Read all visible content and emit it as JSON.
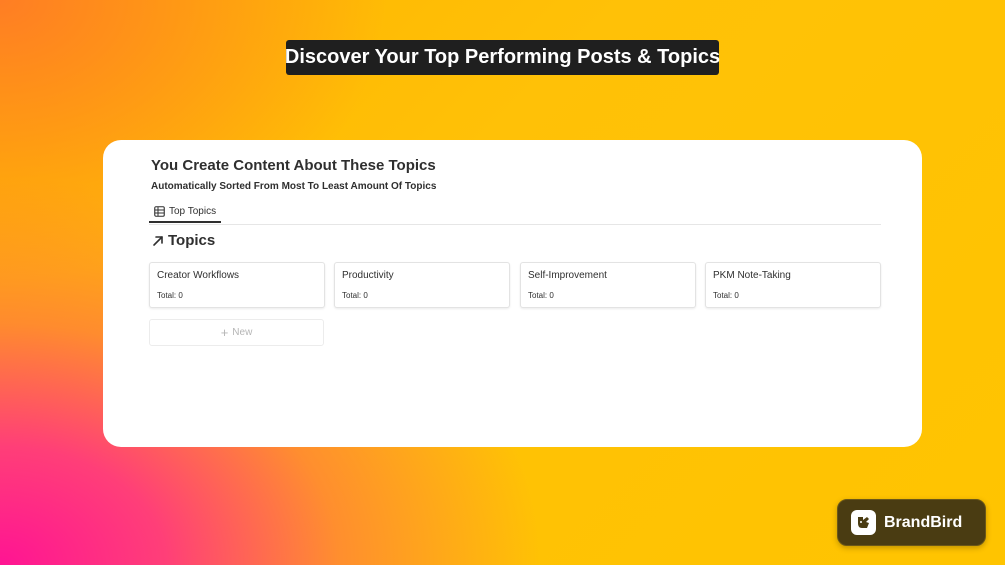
{
  "banner": {
    "title": "Discover Your Top Performing Posts & Topics"
  },
  "page": {
    "heading": "You Create Content About These Topics",
    "subheading": "Automatically Sorted From Most To Least Amount Of Topics"
  },
  "tabs": [
    {
      "label": "Top Topics",
      "icon": "table-icon",
      "active": true
    }
  ],
  "section": {
    "title": "Topics",
    "icon": "arrow-up-right-icon"
  },
  "topics": [
    {
      "name": "Creator Workflows",
      "total": "Total: 0"
    },
    {
      "name": "Productivity",
      "total": "Total: 0"
    },
    {
      "name": "Self-Improvement",
      "total": "Total: 0"
    },
    {
      "name": "PKM Note-Taking",
      "total": "Total: 0"
    }
  ],
  "new_button": {
    "label": "New",
    "icon": "plus-icon"
  },
  "brand": {
    "name": "BrandBird",
    "logo_icon": "bird-logo-icon"
  },
  "colors": {
    "gradient_pink": "#ff1493",
    "gradient_yellow": "#ffc107",
    "banner_bg": "#1f1f1f",
    "brand_badge_bg": "#4a3c12"
  }
}
